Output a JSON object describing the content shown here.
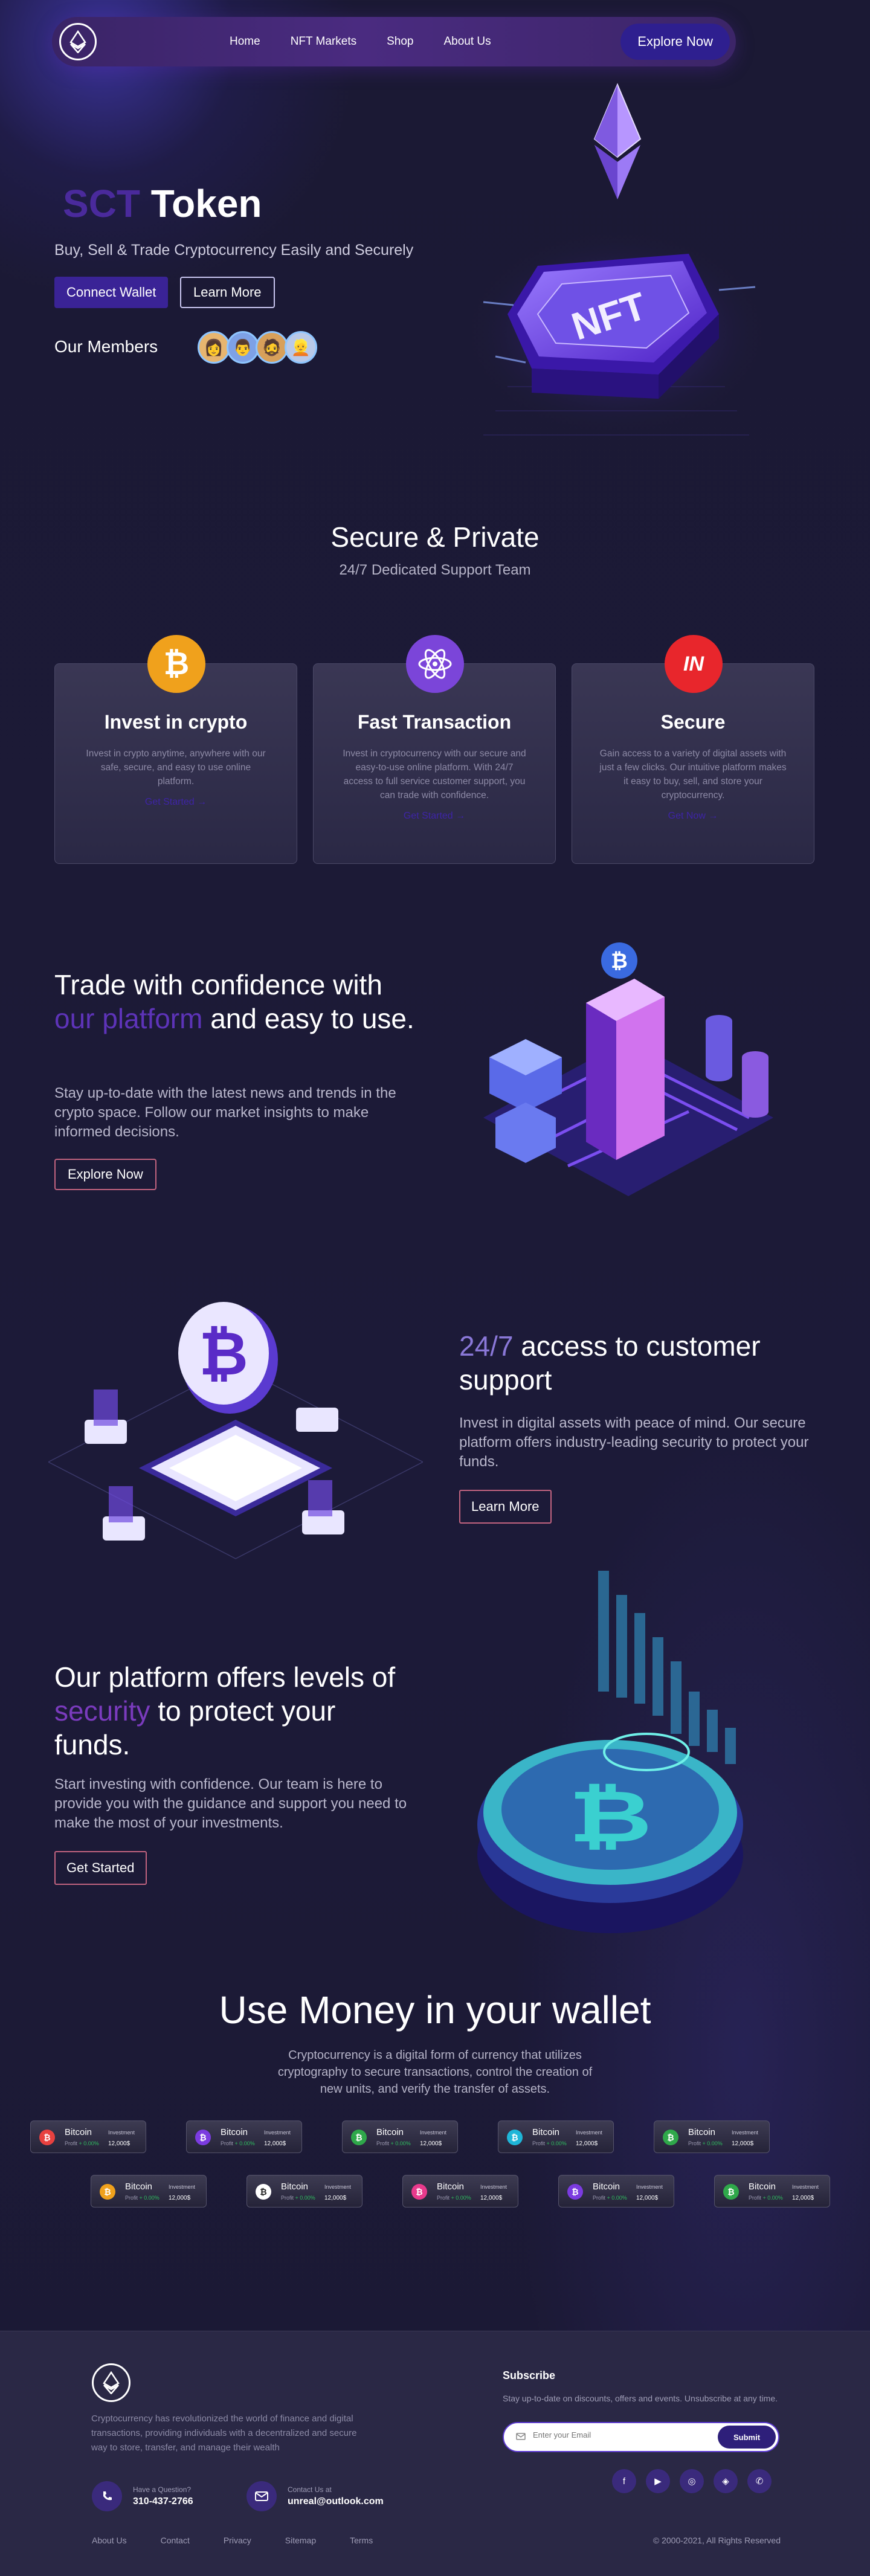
{
  "nav": {
    "links": [
      "Home",
      "NFT Markets",
      "Shop",
      "About Us"
    ],
    "cta": "Explore Now"
  },
  "hero": {
    "title_accent": "SCT",
    "title_rest": " Token",
    "subtitle": "Buy, Sell & Trade Cryptocurrency Easily and Securely",
    "primary_button": "Connect Wallet",
    "secondary_button": "Learn More",
    "members_label": "Our Members",
    "nft_label": "NFT"
  },
  "secure": {
    "title": "Secure & Private",
    "subtitle": "24/7 Dedicated Support Team"
  },
  "cards": [
    {
      "title": "Invest in crypto",
      "text": "Invest in crypto anytime, anywhere with our safe, secure, and easy to use online platform.",
      "link": "Get Started",
      "color": "#f0a11c",
      "icon": "bitcoin-icon"
    },
    {
      "title": "Fast Transaction",
      "text": "Invest in cryptocurrency with our secure and easy-to-use online platform. With 24/7 access to full service customer support, you can trade with confidence.",
      "link": "Get Started",
      "color": "#7b45d9",
      "icon": "atom-icon"
    },
    {
      "title": "Secure",
      "text": "Gain access to a variety of digital assets with just a few clicks. Our intuitive platform makes it easy to buy, sell, and store your cryptocurrency.",
      "link": "Get Now",
      "color": "#e8262c",
      "icon": "flag-logo-icon"
    }
  ],
  "trade": {
    "title_1": "Trade with confidence with",
    "title_accent": "our platform",
    "title_2": " and easy to use.",
    "text": "Stay up-to-date with the latest news and trends in the crypto space. Follow our market insights to make informed decisions.",
    "button": "Explore Now"
  },
  "access": {
    "title_accent": "24/7",
    "title_rest": " access to customer support",
    "text": "Invest in digital assets with peace of mind. Our secure platform offers industry-leading security to protect your funds.",
    "button": "Learn More"
  },
  "security": {
    "title_1": "Our platform offers  levels of ",
    "title_accent": "security",
    "title_2": " to protect your funds.",
    "text": "Start investing with confidence. Our team is here to provide you with the guidance and support you need to make the most of your investments.",
    "button": "Get Started"
  },
  "wallet": {
    "title": "Use Money in your wallet",
    "text": "Cryptocurrency is a digital form of currency that utilizes cryptography to secure transactions, control the creation of new units, and verify the transfer of assets.",
    "ticker": {
      "name": "Bitcoin",
      "investment_label": "Investment",
      "profit_label": "Profit",
      "profit_value": "+ 0.00%",
      "amount": "12,000$"
    },
    "ticker_colors": [
      "#e8413f",
      "#7b3be0",
      "#2fa84a",
      "#1fb6d8",
      "#2fa84a",
      "#f0a11c",
      "#ffffff",
      "#e83a8c",
      "#7b3be0",
      "#2fa84a"
    ]
  },
  "footer": {
    "description": "Cryptocurrency has revolutionized the world of finance and digital transactions, providing individuals with a decentralized and secure way to store, transfer, and manage their wealth",
    "phone_label": "Have a Question?",
    "phone": "310-437-2766",
    "email_label": "Contact Us at",
    "email": "unreal@outlook.com",
    "links": [
      "About Us",
      "Contact",
      "Privacy",
      "Sitemap",
      "Terms"
    ],
    "copyright": "© 2000-2021, All Rights Reserved",
    "subscribe_title": "Subscribe",
    "subscribe_text": "Stay up-to-date on discounts, offers and events. Unsubscribe at any time.",
    "email_placeholder": "Enter your Email",
    "submit": "Submit",
    "socials": [
      "facebook-icon",
      "youtube-icon",
      "dribbble-icon",
      "figma-icon",
      "whatsapp-icon"
    ]
  }
}
